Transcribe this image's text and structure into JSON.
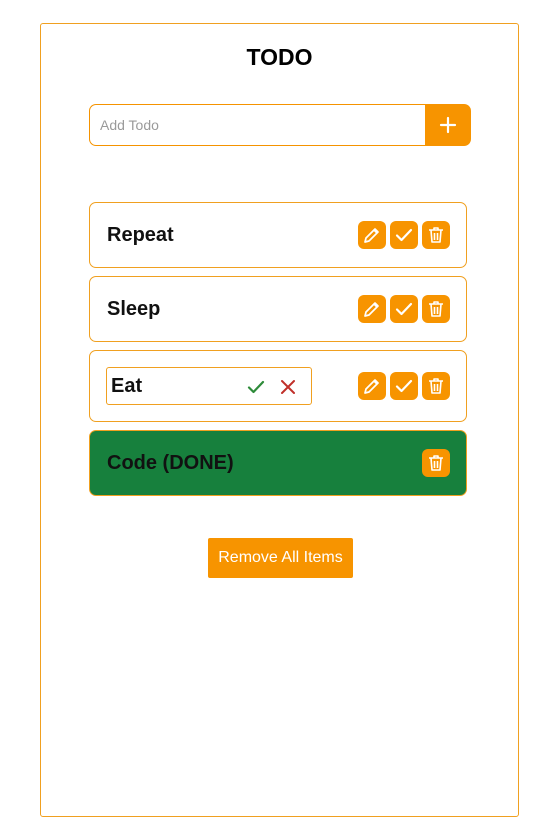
{
  "app": {
    "title": "TODO"
  },
  "add": {
    "placeholder": "Add Todo",
    "icon": "plus-icon"
  },
  "todos": [
    {
      "text": "Repeat",
      "done": false,
      "editing": false
    },
    {
      "text": "Sleep",
      "done": false,
      "editing": false
    },
    {
      "text": "Eat",
      "done": false,
      "editing": true
    },
    {
      "text": "Code (DONE)",
      "done": true,
      "editing": false
    }
  ],
  "edit": {
    "value": "Eat"
  },
  "actions": {
    "remove_all_label": "Remove All Items"
  },
  "colors": {
    "accent": "#f79400",
    "done_bg": "#17803d",
    "confirm": "#2e8b3a",
    "cancel": "#c0302a"
  }
}
